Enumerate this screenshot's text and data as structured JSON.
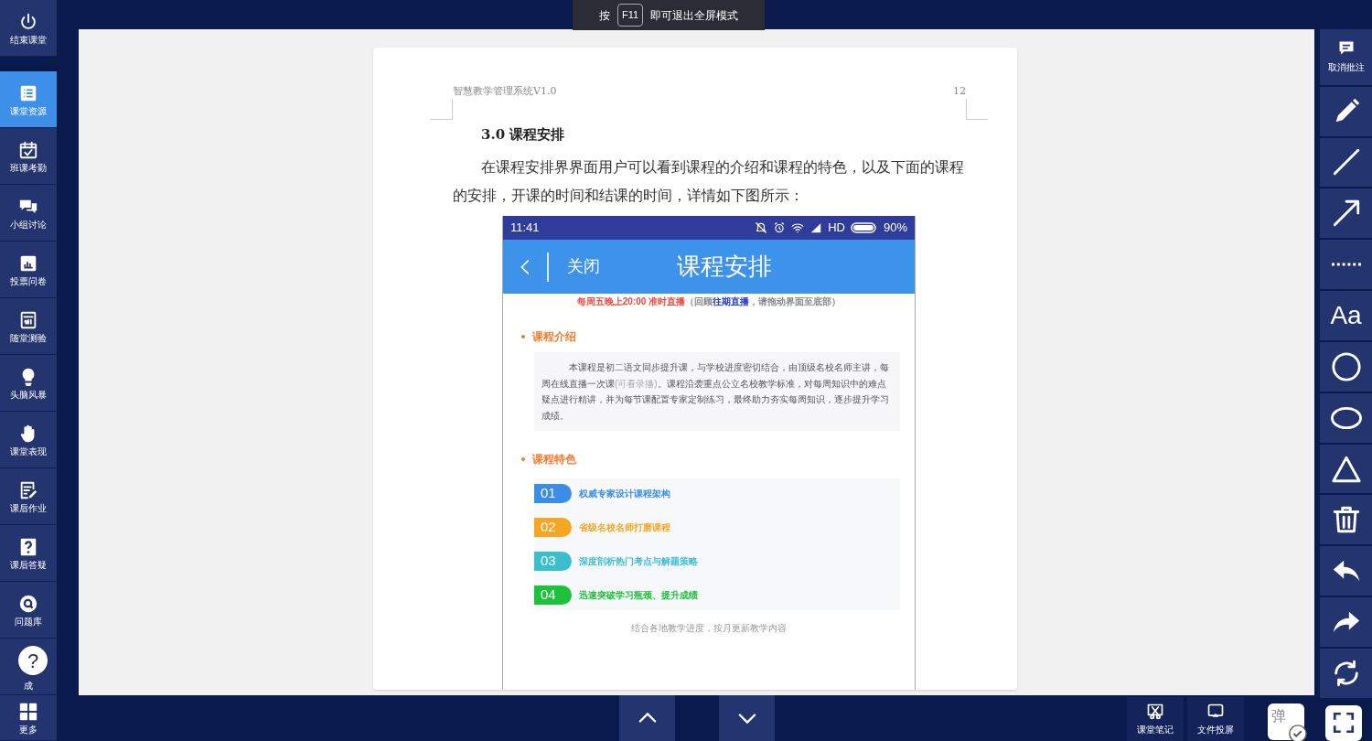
{
  "fullscreen_hint": {
    "prefix": "按",
    "key": "F11",
    "suffix": "即可退出全屏模式"
  },
  "sidebar": {
    "items": [
      {
        "label": "结束课堂",
        "selected": false
      },
      {
        "label": "课堂资源",
        "selected": true
      },
      {
        "label": "班课考勤",
        "selected": false
      },
      {
        "label": "小组讨论",
        "selected": false
      },
      {
        "label": "投票问卷",
        "selected": false
      },
      {
        "label": "随堂测验",
        "selected": false
      },
      {
        "label": "头脑风暴",
        "selected": false
      },
      {
        "label": "课堂表现",
        "selected": false
      },
      {
        "label": "课后作业",
        "selected": false
      },
      {
        "label": "课后答疑",
        "selected": false
      },
      {
        "label": "问题库",
        "selected": false
      },
      {
        "label": "成",
        "selected": false
      },
      {
        "label": "更多",
        "selected": false
      }
    ]
  },
  "help_button": "?",
  "document": {
    "header_title": "智慧教学管理系统V1.0",
    "page_number": "12",
    "heading": "3.0 课程安排",
    "paragraph": "在课程安排界界面用户可以看到课程的介绍和课程的特色，以及下面的课程的安排，开课的时间和结课的时间，详情如下图所示：",
    "phone": {
      "time": "11:41",
      "network": "HD",
      "battery": "90%",
      "back_label": "关闭",
      "title": "课程安排",
      "notice": [
        {
          "text": "每周五晚上20:00 准时直播",
          "color": "#f0463c"
        },
        {
          "text": "（回顾",
          "color": "#888888"
        },
        {
          "text": "往期直播",
          "color": "#2233dd"
        },
        {
          "text": "，请拖动界面至底部）",
          "color": "#888888"
        }
      ],
      "intro_heading": "课程介绍",
      "intro": [
        {
          "text": "本课程是初二语文同步提升课，与学校进度密切结合，由顶级名校名师主讲，每周在线直播一次课",
          "color": "#555555"
        },
        {
          "text": "(可看录播)",
          "color": "#aaaaaa"
        },
        {
          "text": "。课程沿袭重点公立名校教学标准，对每周知识中的难点疑点进行精讲，并为每节课配置专家定制练习，最终助力夯实每周知识，逐步提升学习成绩。",
          "color": "#555555"
        }
      ],
      "features_heading": "课程特色",
      "features": [
        {
          "number": "01",
          "text": "权威专家设计课程架构",
          "color": "#3a8ee6"
        },
        {
          "number": "02",
          "text": "省级名校名师打磨课程",
          "color": "#f5a623"
        },
        {
          "number": "03",
          "text": "深度剖析热门考点与解题策略",
          "color": "#3bbfcf"
        },
        {
          "number": "04",
          "text": "迅速突破学习瓶颈、提升成绩",
          "color": "#1cc23a"
        }
      ],
      "footer": "结合各地教学进度，按月更新教学内容"
    }
  },
  "right_toolbar": {
    "cancel_label": "取消批注",
    "text_tool": "Aa"
  },
  "bottom_bar": {
    "notes_label": "课堂笔记",
    "cast_label": "文件投屏",
    "popup_label": "弹"
  }
}
